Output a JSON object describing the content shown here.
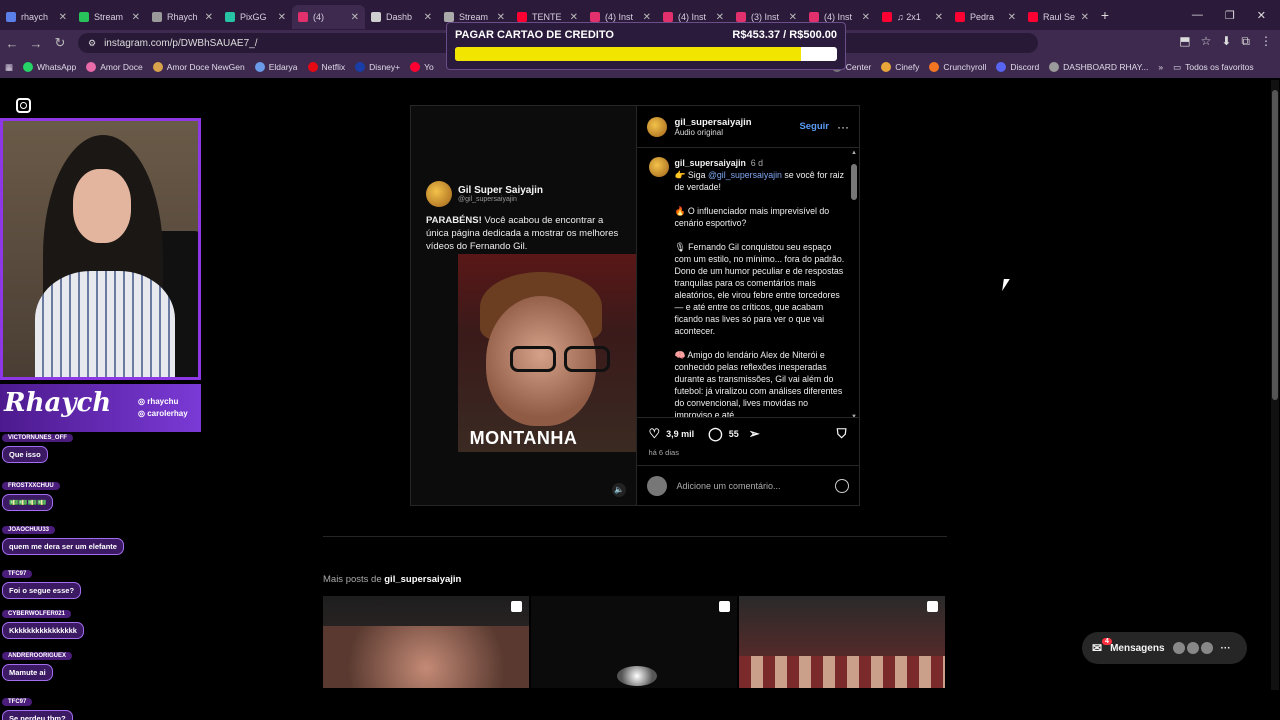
{
  "tabs": [
    {
      "label": "rhaych",
      "color": "#5b7fe8"
    },
    {
      "label": "Stream",
      "color": "#27c35a"
    },
    {
      "label": "Rhaych",
      "color": "#9a9a9a"
    },
    {
      "label": "PixGG",
      "color": "#27c3a5"
    },
    {
      "label": "(4)",
      "color": "#e1306c",
      "active": true
    },
    {
      "label": "Dashb",
      "color": "#cfcfcf"
    },
    {
      "label": "Stream",
      "color": "#aaaaaa"
    },
    {
      "label": "TENTE",
      "color": "#ff0033"
    },
    {
      "label": "(4) Inst",
      "color": "#e1306c"
    },
    {
      "label": "(4) Inst",
      "color": "#e1306c"
    },
    {
      "label": "(3) Inst",
      "color": "#e1306c"
    },
    {
      "label": "(4) Inst",
      "color": "#e1306c"
    },
    {
      "label": "♫ 2x1",
      "color": "#ff0033"
    },
    {
      "label": "Pedra",
      "color": "#ff0033"
    },
    {
      "label": "Raul Se",
      "color": "#ff0033"
    }
  ],
  "url": "instagram.com/p/DWBhSAUAE7_/",
  "bookmarks": [
    {
      "label": "WhatsApp",
      "color": "#25d366"
    },
    {
      "label": "Amor Doce",
      "color": "#e86aa8"
    },
    {
      "label": "Amor Doce NewGen",
      "color": "#d8a34a"
    },
    {
      "label": "Eldarya",
      "color": "#6a9be8"
    },
    {
      "label": "Netflix",
      "color": "#e50914"
    },
    {
      "label": "Disney+",
      "color": "#1a3ea8"
    },
    {
      "label": "Yo",
      "color": "#ff0033"
    }
  ],
  "bookmarks_right": [
    {
      "label": "Center",
      "color": "#777777"
    },
    {
      "label": "Cinefy",
      "color": "#e8a63a"
    },
    {
      "label": "Crunchyroll",
      "color": "#f47521"
    },
    {
      "label": "Discord",
      "color": "#5865f2"
    },
    {
      "label": "DASHBOARD RHAY...",
      "color": "#9a9a9a"
    }
  ],
  "all_favorites": "Todos os favoritos",
  "donation": {
    "title": "PAGAR CARTAO DE CREDITO",
    "amount": "R$453.37 / R$500.00",
    "progress": 0.907
  },
  "post": {
    "username": "gil_supersaiyajin",
    "audio": "Áudio original",
    "follow": "Seguir",
    "video": {
      "channel_name": "Gil Super Saiyajin",
      "channel_handle": "@gil_supersaiyajin",
      "text_bold": "PARABÉNS!",
      "text": " Você acabou de encontrar a única página dedicada a mostrar os melhores vídeos do Fernando Gil.",
      "caption": "MONTANHA"
    },
    "caption": {
      "username": "gil_supersaiyajin",
      "time": "6 d",
      "line1_prefix": "👉 Siga ",
      "mention": "@gil_supersaiyajin",
      "line1_suffix": " se você for raiz de verdade!",
      "p2": "🔥 O influenciador mais imprevisível do cenário esportivo?",
      "p3": "🎙 Fernando Gil conquistou seu espaço com um estilo, no mínimo... fora do padrão. Dono de um humor peculiar e de respostas tranquilas para os comentários mais aleatórios, ele virou febre entre torcedores — e até entre os críticos, que acabam ficando nas lives só para ver o que vai acontecer.",
      "p4": "🧠 Amigo do lendário Alex de Niterói e conhecido pelas reflexões inesperadas durante as transmissões, Gil vai além do futebol: já viralizou com análises diferentes do convencional, lives movidas no improviso e até"
    },
    "likes": "3,9 mil",
    "comments": "55",
    "ago": "há 6 dias",
    "add_comment": "Adicione um comentário..."
  },
  "more_posts": {
    "label": "Mais posts de ",
    "username": "gil_supersaiyajin"
  },
  "messages": {
    "label": "Mensagens",
    "badge": "4"
  },
  "stream": {
    "logo": "Rhaych",
    "social1": "rhaychu",
    "social2": "carolerhay",
    "chat": [
      {
        "user": "VICTORNUNES_OFF",
        "text": "Que isso"
      },
      {
        "user": "FROSTXXCHUU",
        "text": "💵💵💵💵"
      },
      {
        "user": "JOAOCHUU33",
        "text": "quem me dera ser um elefante"
      },
      {
        "user": "TFC97",
        "text": "Foi o segue esse?"
      },
      {
        "user": "CYBERWOLFER021",
        "text": "Kkkkkkkkkkkkkkkk"
      },
      {
        "user": "ANDREROORIGUEX",
        "text": "Mamute ai"
      },
      {
        "user": "TFC97",
        "text": "Se perdeu tbm?"
      }
    ]
  }
}
